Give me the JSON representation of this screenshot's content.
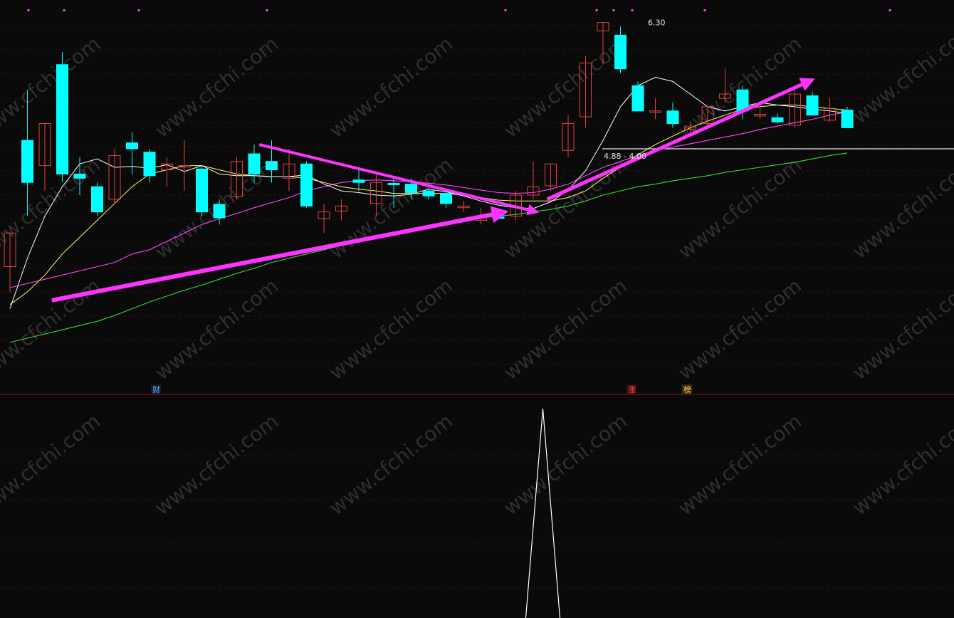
{
  "watermark": "www.cfchi.com",
  "markers": {
    "finance": "财",
    "limit_up": "涨",
    "rank": "榜"
  },
  "annotations": {
    "high_price": "6.30",
    "range_label": "4.88 - 4.00"
  },
  "colors": {
    "background": "#0a0a0a",
    "up_candle": "#e0413a",
    "down_candle": "#00ffff",
    "ma5": "#ffffff",
    "ma10": "#ffff66",
    "ma30": "#ff44ff",
    "ma60": "#33dd33",
    "arrow": "#ff33ff",
    "grid": "#5a0f0f",
    "separator": "#8b1a1a",
    "reference_line": "#c8c8c8"
  },
  "chart_data": [
    {
      "type": "candlestick",
      "ylim": [
        2.0,
        6.5
      ],
      "candles": [
        {
          "o": 3.4,
          "h": 3.6,
          "l": 3.1,
          "c": 3.8
        },
        {
          "o": 4.9,
          "h": 5.5,
          "l": 4.0,
          "c": 4.4
        },
        {
          "o": 4.6,
          "h": 4.8,
          "l": 4.3,
          "c": 5.1
        },
        {
          "o": 5.8,
          "h": 5.95,
          "l": 4.4,
          "c": 4.5
        },
        {
          "o": 4.5,
          "h": 4.7,
          "l": 4.25,
          "c": 4.45
        },
        {
          "o": 4.35,
          "h": 4.4,
          "l": 4.0,
          "c": 4.05
        },
        {
          "o": 4.2,
          "h": 4.8,
          "l": 4.15,
          "c": 4.72
        },
        {
          "o": 4.87,
          "h": 5.0,
          "l": 4.5,
          "c": 4.8
        },
        {
          "o": 4.76,
          "h": 4.8,
          "l": 4.4,
          "c": 4.48
        },
        {
          "o": 4.55,
          "h": 4.7,
          "l": 4.35,
          "c": 4.62
        },
        {
          "o": 4.6,
          "h": 4.9,
          "l": 4.3,
          "c": 4.6
        },
        {
          "o": 4.56,
          "h": 4.6,
          "l": 4.0,
          "c": 4.05
        },
        {
          "o": 4.14,
          "h": 4.2,
          "l": 3.9,
          "c": 3.98
        },
        {
          "o": 4.23,
          "h": 4.7,
          "l": 4.2,
          "c": 4.65
        },
        {
          "o": 4.74,
          "h": 4.85,
          "l": 4.4,
          "c": 4.5
        },
        {
          "o": 4.65,
          "h": 4.9,
          "l": 4.4,
          "c": 4.55
        },
        {
          "o": 4.45,
          "h": 4.8,
          "l": 4.3,
          "c": 4.62
        },
        {
          "o": 4.62,
          "h": 4.65,
          "l": 4.1,
          "c": 4.12
        },
        {
          "o": 3.97,
          "h": 4.15,
          "l": 3.8,
          "c": 4.05
        },
        {
          "o": 4.06,
          "h": 4.2,
          "l": 3.95,
          "c": 4.12
        },
        {
          "o": 4.43,
          "h": 4.55,
          "l": 4.3,
          "c": 4.4
        },
        {
          "o": 4.15,
          "h": 4.5,
          "l": 4.0,
          "c": 4.4
        },
        {
          "o": 4.39,
          "h": 4.45,
          "l": 4.1,
          "c": 4.38
        },
        {
          "o": 4.38,
          "h": 4.45,
          "l": 4.2,
          "c": 4.28
        },
        {
          "o": 4.3,
          "h": 4.35,
          "l": 4.2,
          "c": 4.24
        },
        {
          "o": 4.27,
          "h": 4.3,
          "l": 4.1,
          "c": 4.15
        },
        {
          "o": 4.1,
          "h": 4.18,
          "l": 4.05,
          "c": 4.12
        },
        {
          "o": 3.95,
          "h": 4.1,
          "l": 3.9,
          "c": 4.0
        },
        {
          "o": 3.99,
          "h": 4.05,
          "l": 3.96,
          "c": 3.98
        },
        {
          "o": 4.0,
          "h": 4.3,
          "l": 3.95,
          "c": 4.25
        },
        {
          "o": 4.25,
          "h": 4.65,
          "l": 4.2,
          "c": 4.35
        },
        {
          "o": 4.36,
          "h": 4.6,
          "l": 4.3,
          "c": 4.62
        },
        {
          "o": 4.78,
          "h": 5.2,
          "l": 4.7,
          "c": 5.1
        },
        {
          "o": 5.18,
          "h": 5.9,
          "l": 5.05,
          "c": 5.82
        },
        {
          "o": 6.2,
          "h": 6.3,
          "l": 5.8,
          "c": 6.3
        },
        {
          "o": 6.15,
          "h": 6.25,
          "l": 5.7,
          "c": 5.75
        },
        {
          "o": 5.55,
          "h": 5.6,
          "l": 5.25,
          "c": 5.25
        },
        {
          "o": 5.25,
          "h": 5.4,
          "l": 5.15,
          "c": 5.25
        },
        {
          "o": 5.25,
          "h": 5.35,
          "l": 5.05,
          "c": 5.1
        },
        {
          "o": 5.03,
          "h": 5.1,
          "l": 4.98,
          "c": 5.06
        },
        {
          "o": 5.1,
          "h": 5.3,
          "l": 5.05,
          "c": 5.3
        },
        {
          "o": 5.4,
          "h": 5.75,
          "l": 5.35,
          "c": 5.45
        },
        {
          "o": 5.5,
          "h": 5.55,
          "l": 5.15,
          "c": 5.25
        },
        {
          "o": 5.19,
          "h": 5.3,
          "l": 5.15,
          "c": 5.21
        },
        {
          "o": 5.17,
          "h": 5.22,
          "l": 5.1,
          "c": 5.12
        },
        {
          "o": 5.08,
          "h": 5.5,
          "l": 5.05,
          "c": 5.45
        },
        {
          "o": 5.43,
          "h": 5.48,
          "l": 5.2,
          "c": 5.2
        },
        {
          "o": 5.14,
          "h": 5.4,
          "l": 5.12,
          "c": 5.28
        },
        {
          "o": 5.26,
          "h": 5.3,
          "l": 5.05,
          "c": 5.05
        }
      ],
      "ma5": [
        2.9,
        3.5,
        4.0,
        4.35,
        4.62,
        4.68,
        4.58,
        4.59,
        4.57,
        4.61,
        4.53,
        4.6,
        4.5,
        4.48,
        4.48,
        4.47,
        4.47,
        4.49,
        4.38,
        4.3,
        4.28,
        4.25,
        4.24,
        4.26,
        4.32,
        4.29,
        4.24,
        4.18,
        4.13,
        4.1,
        4.09,
        4.17,
        4.31,
        4.54,
        4.9,
        5.3,
        5.55,
        5.65,
        5.6,
        5.45,
        5.3,
        5.25,
        5.3,
        5.35,
        5.32,
        5.3,
        5.27,
        5.25,
        5.22
      ],
      "ma10": [
        2.95,
        3.1,
        3.3,
        3.55,
        3.75,
        3.95,
        4.15,
        4.35,
        4.5,
        4.55,
        4.6,
        4.6,
        4.55,
        4.5,
        4.48,
        4.47,
        4.47,
        4.45,
        4.4,
        4.35,
        4.32,
        4.3,
        4.27,
        4.27,
        4.27,
        4.27,
        4.25,
        4.22,
        4.19,
        4.18,
        4.18,
        4.18,
        4.22,
        4.3,
        4.45,
        4.58,
        4.73,
        4.85,
        4.95,
        5.05,
        5.13,
        5.2,
        5.27,
        5.3,
        5.32,
        5.32,
        5.3,
        5.28,
        5.26
      ],
      "ma30": [
        3.15,
        3.2,
        3.25,
        3.3,
        3.35,
        3.4,
        3.45,
        3.55,
        3.6,
        3.7,
        3.8,
        3.9,
        3.97,
        4.03,
        4.1,
        4.16,
        4.22,
        4.3,
        4.35,
        4.4,
        4.42,
        4.43,
        4.42,
        4.41,
        4.39,
        4.37,
        4.34,
        4.31,
        4.28,
        4.27,
        4.28,
        4.32,
        4.38,
        4.48,
        4.58,
        4.65,
        4.72,
        4.78,
        4.82,
        4.86,
        4.9,
        4.94,
        4.98,
        5.03,
        5.07,
        5.11,
        5.15,
        5.2,
        5.24
      ],
      "ma60": [
        2.5,
        2.55,
        2.6,
        2.65,
        2.7,
        2.75,
        2.82,
        2.9,
        2.98,
        3.05,
        3.12,
        3.18,
        3.25,
        3.32,
        3.38,
        3.45,
        3.5,
        3.55,
        3.6,
        3.65,
        3.7,
        3.75,
        3.8,
        3.85,
        3.88,
        3.92,
        3.95,
        3.98,
        4.0,
        4.02,
        4.05,
        4.08,
        4.12,
        4.18,
        4.25,
        4.3,
        4.35,
        4.38,
        4.42,
        4.45,
        4.48,
        4.52,
        4.55,
        4.58,
        4.61,
        4.64,
        4.68,
        4.72,
        4.75
      ]
    },
    {
      "type": "line",
      "series": [
        {
          "values": [
            0,
            0,
            0,
            0,
            0,
            0,
            0,
            0,
            0,
            0,
            0,
            0,
            0,
            0,
            0,
            0,
            0,
            0,
            0,
            0,
            0,
            0,
            0,
            0,
            0,
            0,
            0,
            0,
            0,
            0,
            0,
            1,
            0,
            0,
            0,
            0,
            0,
            0,
            0,
            0,
            0,
            0,
            0,
            0,
            0,
            0,
            0,
            0,
            0
          ]
        }
      ]
    }
  ]
}
